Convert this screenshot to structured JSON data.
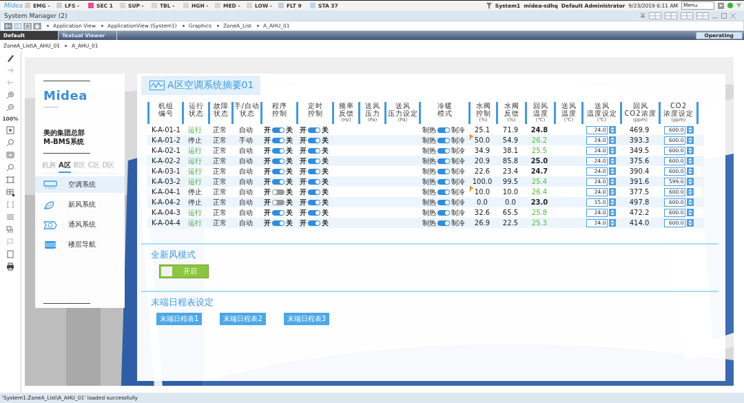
{
  "alarm_bar": {
    "logo": "Midea",
    "categories": [
      {
        "label": "EMG",
        "count": "-",
        "color": "#cfcfcf"
      },
      {
        "label": "LFS",
        "count": "-",
        "color": "#cfcfcf"
      },
      {
        "label": "SEC",
        "count": "1",
        "color": "#e0509a"
      },
      {
        "label": "SUP",
        "count": "-",
        "color": "#d6d6d6"
      },
      {
        "label": "TBL",
        "count": "-",
        "color": "#d6d6d6"
      },
      {
        "label": "HGH",
        "count": "-",
        "color": "#d6d6d6"
      },
      {
        "label": "MED",
        "count": "-",
        "color": "#d6d6d6"
      },
      {
        "label": "LOW",
        "count": "-",
        "color": "#d6d6d6"
      },
      {
        "label": "FLT",
        "count": "9",
        "color": "#c9ccd6"
      },
      {
        "label": "STA",
        "count": "37",
        "color": "#b8d8f0"
      }
    ],
    "system": "System1",
    "site": "midea-sdhq",
    "user": "Default Administrator",
    "datetime": "9/23/2019 6:11 AM",
    "menu": "Menu"
  },
  "window": {
    "title": "System Manager (2)"
  },
  "breadcrumb": [
    "Application View",
    "ApplicationView (System1)",
    "Graphics",
    "ZoneA_List",
    "A_AHU_01"
  ],
  "tabs": [
    {
      "label": "Default",
      "selected": true
    },
    {
      "label": "Textual Viewer",
      "selected": false
    }
  ],
  "mode_badge": "Operating",
  "path": [
    "ZoneA_List\\A_AHU_01",
    "A_AHU_01"
  ],
  "toolbar": {
    "zoom": "100%"
  },
  "nav_panel": {
    "logo": "Midea",
    "org": "美的集团总部",
    "system": "M-BMS系统",
    "zones": [
      {
        "label": "机房",
        "selected": false
      },
      {
        "label": "A区",
        "selected": true
      },
      {
        "label": "B区",
        "selected": false
      },
      {
        "label": "C区",
        "selected": false
      },
      {
        "label": "D区",
        "selected": false
      }
    ],
    "items": [
      {
        "label": "空调系统",
        "kind": "ac",
        "selected": true
      },
      {
        "label": "新风系统",
        "kind": "fresh",
        "selected": false
      },
      {
        "label": "通风系统",
        "kind": "vent",
        "selected": false
      },
      {
        "label": "楼层导航",
        "kind": "floor",
        "selected": false
      }
    ]
  },
  "summary": {
    "title": "A区空调系统摘要01",
    "columns": [
      {
        "lines": [
          "机组",
          "编号"
        ]
      },
      {
        "lines": [
          "运行",
          "状态"
        ]
      },
      {
        "lines": [
          "故障",
          "状态"
        ]
      },
      {
        "lines": [
          "手/自动",
          "状态"
        ]
      },
      {
        "lines": [
          "程序",
          "控制"
        ]
      },
      {
        "lines": [
          "定时",
          "控制"
        ]
      },
      {
        "lines": [
          "频率",
          "反馈"
        ],
        "unit": "(Hz)"
      },
      {
        "lines": [
          "送风",
          "压力"
        ],
        "unit": "(Pa)"
      },
      {
        "lines": [
          "送风",
          "压力设定"
        ],
        "unit": "(Pa)"
      },
      {
        "lines": [
          "冷暖",
          "模式"
        ]
      },
      {
        "lines": [
          "水阀",
          "控制"
        ],
        "unit": "(%)"
      },
      {
        "lines": [
          "水阀",
          "反馈"
        ],
        "unit": "(%)"
      },
      {
        "lines": [
          "回风",
          "温度"
        ],
        "unit": "(℃)"
      },
      {
        "lines": [
          "送风",
          "温度"
        ],
        "unit": "(℃)"
      },
      {
        "lines": [
          "送风",
          "温度设定"
        ],
        "unit": "(℃)"
      },
      {
        "lines": [
          "回风",
          "CO2浓度"
        ],
        "unit": "(ppm)"
      },
      {
        "lines": [
          "CO2",
          "浓度设定"
        ],
        "unit": "(ppm)"
      }
    ],
    "rows": [
      {
        "id": "K-A-01-1",
        "run": "运行",
        "running": true,
        "fault": "正常",
        "mode": "自动",
        "program": {
          "on_label": "开",
          "off_label": "关",
          "on": true
        },
        "timer": {
          "on_label": "开",
          "off_label": "关",
          "on": true
        },
        "season": {
          "heat": "制热",
          "cool": "制冷",
          "on": true
        },
        "valve": "25.1",
        "valve_alarm": false,
        "valve_feedback": "71.9",
        "return_temp": "24.8",
        "temp_alert": false,
        "supply_setpoint": "24.0",
        "return_co2": "469.9",
        "co2_setpoint": "600.0"
      },
      {
        "id": "K-A-01-2",
        "run": "停止",
        "running": false,
        "fault": "正常",
        "mode": "手动",
        "program": {
          "on_label": "开",
          "off_label": "关",
          "on": true
        },
        "timer": {
          "on_label": "开",
          "off_label": "关",
          "on": true
        },
        "season": {
          "heat": "制热",
          "cool": "制冷",
          "on": true
        },
        "valve": "50.0",
        "valve_alarm": true,
        "valve_feedback": "54.9",
        "return_temp": "26.2",
        "temp_alert": true,
        "supply_setpoint": "24.0",
        "return_co2": "393.3",
        "co2_setpoint": "600.0"
      },
      {
        "id": "K-A-02-1",
        "run": "运行",
        "running": true,
        "fault": "正常",
        "mode": "自动",
        "program": {
          "on_label": "开",
          "off_label": "关",
          "on": true
        },
        "timer": {
          "on_label": "开",
          "off_label": "关",
          "on": true
        },
        "season": {
          "heat": "制热",
          "cool": "制冷",
          "on": true
        },
        "valve": "34.9",
        "valve_alarm": false,
        "valve_feedback": "38.1",
        "return_temp": "25.5",
        "temp_alert": true,
        "supply_setpoint": "24.0",
        "return_co2": "349.5",
        "co2_setpoint": "600.0"
      },
      {
        "id": "K-A-02-2",
        "run": "运行",
        "running": true,
        "fault": "正常",
        "mode": "自动",
        "program": {
          "on_label": "开",
          "off_label": "关",
          "on": true
        },
        "timer": {
          "on_label": "开",
          "off_label": "关",
          "on": true
        },
        "season": {
          "heat": "制热",
          "cool": "制冷",
          "on": true
        },
        "valve": "20.9",
        "valve_alarm": false,
        "valve_feedback": "85.8",
        "return_temp": "25.0",
        "temp_alert": false,
        "supply_setpoint": "24.0",
        "return_co2": "375.6",
        "co2_setpoint": "600.0"
      },
      {
        "id": "K-A-03-1",
        "run": "运行",
        "running": true,
        "fault": "正常",
        "mode": "自动",
        "program": {
          "on_label": "开",
          "off_label": "关",
          "on": true
        },
        "timer": {
          "on_label": "开",
          "off_label": "关",
          "on": true
        },
        "season": {
          "heat": "制热",
          "cool": "制冷",
          "on": true
        },
        "valve": "22.6",
        "valve_alarm": false,
        "valve_feedback": "23.4",
        "return_temp": "24.7",
        "temp_alert": false,
        "supply_setpoint": "24.0",
        "return_co2": "390.4",
        "co2_setpoint": "600.0"
      },
      {
        "id": "K-A-03-2",
        "run": "运行",
        "running": true,
        "fault": "正常",
        "mode": "自动",
        "program": {
          "on_label": "开",
          "off_label": "关",
          "on": true
        },
        "timer": {
          "on_label": "开",
          "off_label": "关",
          "on": true
        },
        "season": {
          "heat": "制热",
          "cool": "制冷",
          "on": true
        },
        "valve": "100.0",
        "valve_alarm": false,
        "valve_feedback": "99.5",
        "return_temp": "25.4",
        "temp_alert": true,
        "supply_setpoint": "24.0",
        "return_co2": "391.6",
        "co2_setpoint": "599.0"
      },
      {
        "id": "K-A-04-1",
        "run": "停止",
        "running": false,
        "fault": "正常",
        "mode": "自动",
        "program": {
          "on_label": "开",
          "off_label": "关",
          "on": false
        },
        "timer": {
          "on_label": "开",
          "off_label": "关",
          "on": true
        },
        "season": {
          "heat": "制热",
          "cool": "制冷",
          "on": true
        },
        "valve": "10.0",
        "valve_alarm": true,
        "valve_feedback": "10.0",
        "return_temp": "26.4",
        "temp_alert": true,
        "supply_setpoint": "24.0",
        "return_co2": "377.5",
        "co2_setpoint": "600.0"
      },
      {
        "id": "K-A-04-2",
        "run": "停止",
        "running": false,
        "fault": "正常",
        "mode": "自动",
        "program": {
          "on_label": "开",
          "off_label": "关",
          "on": false
        },
        "timer": {
          "on_label": "开",
          "off_label": "关",
          "on": true
        },
        "season": {
          "heat": "制热",
          "cool": "制冷",
          "on": true
        },
        "valve": "0.0",
        "valve_alarm": false,
        "valve_feedback": "0.0",
        "return_temp": "23.0",
        "temp_alert": false,
        "supply_setpoint": "15.0",
        "return_co2": "497.8",
        "co2_setpoint": "600.0"
      },
      {
        "id": "K-A-04-3",
        "run": "运行",
        "running": true,
        "fault": "正常",
        "mode": "自动",
        "program": {
          "on_label": "开",
          "off_label": "关",
          "on": true
        },
        "timer": {
          "on_label": "开",
          "off_label": "关",
          "on": true
        },
        "season": {
          "heat": "制热",
          "cool": "制冷",
          "on": true
        },
        "valve": "32.6",
        "valve_alarm": false,
        "valve_feedback": "65.5",
        "return_temp": "25.8",
        "temp_alert": true,
        "supply_setpoint": "24.0",
        "return_co2": "472.2",
        "co2_setpoint": "600.0"
      },
      {
        "id": "K-A-04-4",
        "run": "运行",
        "running": true,
        "fault": "正常",
        "mode": "自动",
        "program": {
          "on_label": "开",
          "off_label": "关",
          "on": true
        },
        "timer": {
          "on_label": "开",
          "off_label": "关",
          "on": true
        },
        "season": {
          "heat": "制热",
          "cool": "制冷",
          "on": true
        },
        "valve": "26.9",
        "valve_alarm": false,
        "valve_feedback": "22.5",
        "return_temp": "25.3",
        "temp_alert": true,
        "supply_setpoint": "24.0",
        "return_co2": "414.0",
        "co2_setpoint": "600.0"
      }
    ]
  },
  "fresh_air": {
    "title": "全新风模式",
    "switch": {
      "label": "开启",
      "on": true
    }
  },
  "schedule": {
    "title": "末端日程表设定",
    "buttons": [
      "末端日程表1",
      "末端日程表2",
      "末端日程表3"
    ]
  },
  "status_bar": "'System1:ZoneA_List\\A_AHU_01' loaded successfully"
}
